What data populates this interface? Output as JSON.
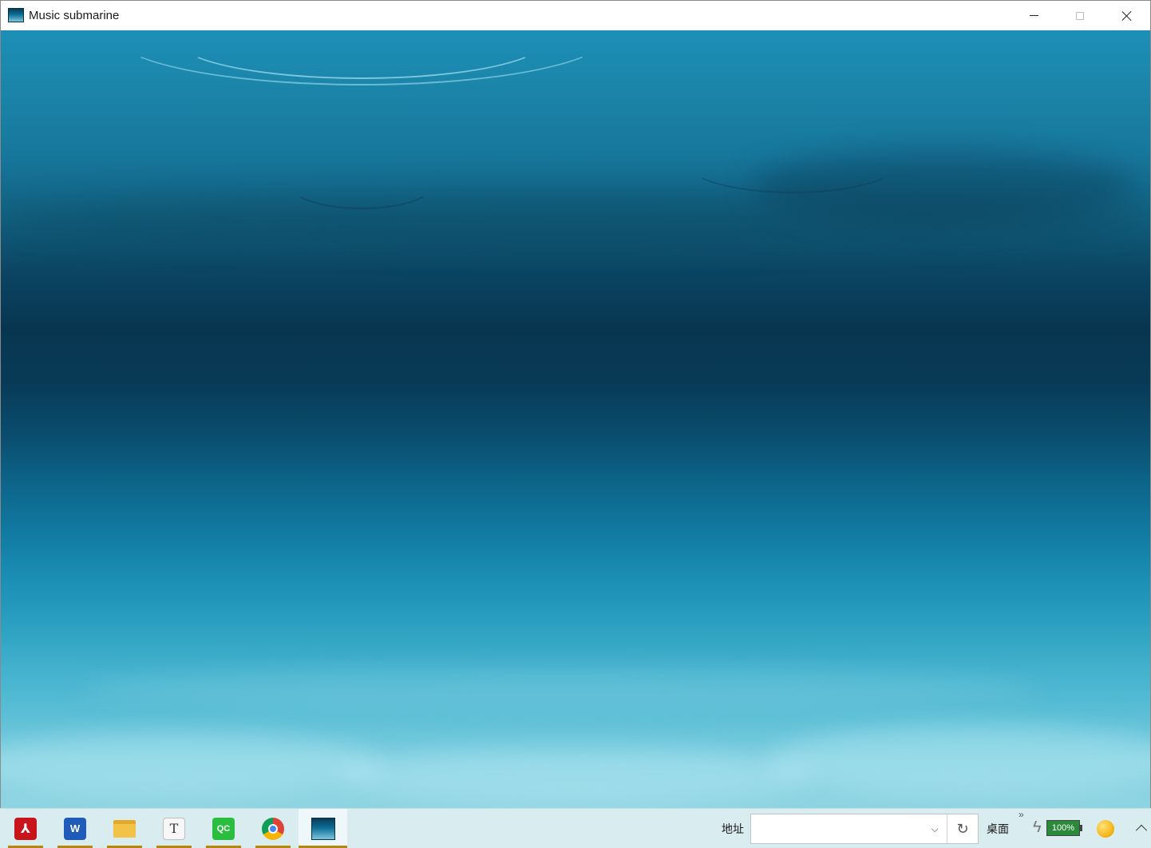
{
  "window": {
    "title": "Music submarine",
    "icon": "submarine-app-icon",
    "controls": {
      "minimize": "minimize-icon",
      "maximize": "maximize-icon",
      "close": "close-icon"
    }
  },
  "scene": {
    "description_icon": "underwater-background"
  },
  "taskbar": {
    "apps": [
      {
        "name": "acrobat",
        "icon": "pdf-icon",
        "glyph": "⅄"
      },
      {
        "name": "word",
        "icon": "word-icon",
        "glyph": "W"
      },
      {
        "name": "file-explorer",
        "icon": "folder-icon",
        "glyph": ""
      },
      {
        "name": "typora",
        "icon": "text-editor-icon",
        "glyph": "T"
      },
      {
        "name": "qq",
        "icon": "qc-icon",
        "glyph": "QC"
      },
      {
        "name": "chrome",
        "icon": "chrome-icon",
        "glyph": ""
      },
      {
        "name": "music-submarine",
        "icon": "submarine-app-icon",
        "glyph": "",
        "active": true
      }
    ],
    "address_label": "地址",
    "address_value": "",
    "address_dropdown_glyph": "⌵",
    "refresh_glyph": "↻",
    "desktop_label": "桌面",
    "more_glyph": "»",
    "power_glyph": "ϟ",
    "battery_text": "100%",
    "colors": {
      "taskbar_bg": "#d9ecef",
      "active_underline": "#b8860b",
      "battery": "#2a8a3a"
    }
  }
}
